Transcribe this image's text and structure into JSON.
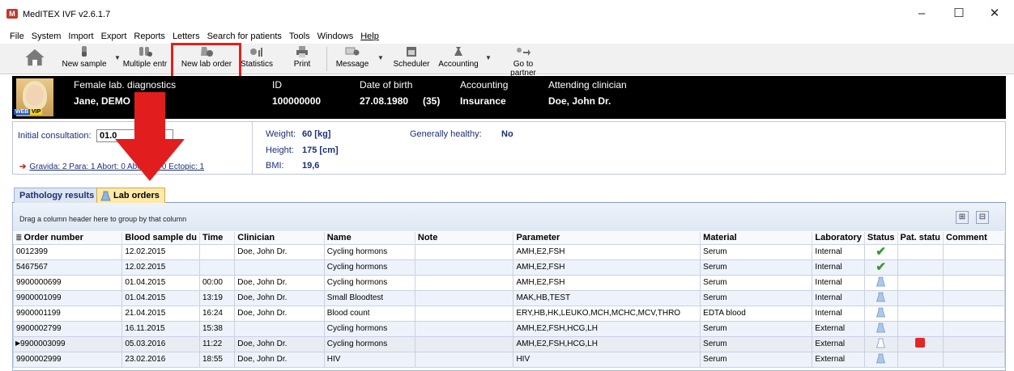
{
  "window": {
    "title": "MedITEX IVF v2.6.1.7",
    "minimize": "–",
    "maximize": "☐",
    "close": "✕"
  },
  "menu": [
    "File",
    "System",
    "Import",
    "Export",
    "Reports",
    "Letters",
    "Search for patients",
    "Tools",
    "Windows",
    "Help"
  ],
  "toolbar": {
    "new_sample": "New sample",
    "multiple_entry": "Multiple entr",
    "new_lab_order": "New lab order",
    "statistics": "Statistics",
    "print": "Print",
    "message": "Message",
    "scheduler": "Scheduler",
    "accounting": "Accounting",
    "go_to_partner": "Go to partner"
  },
  "patient": {
    "category": "Female lab. diagnostics",
    "name": "Jane, DEMO",
    "id_label": "ID",
    "id_value": "100000000",
    "dob_label": "Date of birth",
    "dob_value": "27.08.1980",
    "age": "(35)",
    "accounting_label": "Accounting",
    "accounting_value": "Insurance",
    "clinician_label": "Attending clinician",
    "clinician_value": "Doe, John Dr.",
    "web_badge": "WEB",
    "vip_badge": "VIP"
  },
  "info": {
    "initial_consultation_label": "Initial consultation:",
    "initial_consultation_value": "01.0",
    "gravida_text": "Gravida: 2  Para: 1  Abort: 0  Abortion: 0  Ectopic: 1",
    "weight_label": "Weight:",
    "weight_value": "60  [kg]",
    "height_label": "Height:",
    "height_value": "175  [cm]",
    "bmi_label": "BMI:",
    "bmi_value": "19,6",
    "healthy_label": "Generally healthy:",
    "healthy_value": "No"
  },
  "tabs": {
    "pathology": "Pathology results",
    "lab_orders": "Lab orders"
  },
  "grid": {
    "group_hint": "Drag a column header here to group by that column",
    "expand": "⊞",
    "collapse": "⊟",
    "columns": [
      "Order number",
      "Blood sample du",
      "Time",
      "Clinician",
      "Name",
      "Note",
      "Parameter",
      "Material",
      "Laboratory",
      "Status",
      "Pat. statu",
      "Comment"
    ],
    "rows": [
      {
        "order": "0012399",
        "date": "12.02.2015",
        "time": "",
        "clinician": "Doe, John Dr.",
        "name": "Cycling hormons",
        "note": "",
        "parameter": "AMH,E2,FSH",
        "material": "Serum",
        "lab": "Internal",
        "status": "done",
        "pat": ""
      },
      {
        "order": "5467567",
        "date": "12.02.2015",
        "time": "",
        "clinician": "",
        "name": "Cycling hormons",
        "note": "",
        "parameter": "AMH,E2,FSH",
        "material": "Serum",
        "lab": "Internal",
        "status": "done",
        "pat": ""
      },
      {
        "order": "9900000699",
        "date": "01.04.2015",
        "time": "00:00",
        "clinician": "Doe, John Dr.",
        "name": "Cycling hormons",
        "note": "",
        "parameter": "AMH,E2,FSH",
        "material": "Serum",
        "lab": "Internal",
        "status": "flask",
        "pat": ""
      },
      {
        "order": "9900001099",
        "date": "01.04.2015",
        "time": "13:19",
        "clinician": "Doe, John Dr.",
        "name": "Small Bloodtest",
        "note": "",
        "parameter": "MAK,HB,TEST",
        "material": "Serum",
        "lab": "Internal",
        "status": "flask",
        "pat": ""
      },
      {
        "order": "9900001199",
        "date": "21.04.2015",
        "time": "16:24",
        "clinician": "Doe, John Dr.",
        "name": "Blood count",
        "note": "",
        "parameter": "ERY,HB,HK,LEUKO,MCH,MCHC,MCV,THRO",
        "material": "EDTA blood",
        "lab": "Internal",
        "status": "flask",
        "pat": ""
      },
      {
        "order": "9900002799",
        "date": "16.11.2015",
        "time": "15:38",
        "clinician": "",
        "name": "Cycling hormons",
        "note": "",
        "parameter": "AMH,E2,FSH,HCG,LH",
        "material": "Serum",
        "lab": "External",
        "status": "flask",
        "pat": ""
      },
      {
        "order": "9900003099",
        "date": "05.03.2016",
        "time": "11:22",
        "clinician": "Doe, John Dr.",
        "name": "Cycling hormons",
        "note": "",
        "parameter": "AMH,E2,FSH,HCG,LH",
        "material": "Serum",
        "lab": "External",
        "status": "flask-empty",
        "pat": "phone"
      },
      {
        "order": "9900002999",
        "date": "23.02.2016",
        "time": "18:55",
        "clinician": "Doe, John Dr.",
        "name": "HIV",
        "note": "",
        "parameter": "HIV",
        "material": "Serum",
        "lab": "External",
        "status": "flask",
        "pat": ""
      }
    ]
  },
  "colors": {
    "highlight": "#e02020",
    "header_bg": "#000000",
    "label_blue": "#1c2f78",
    "check_green": "#2e9d2e"
  }
}
